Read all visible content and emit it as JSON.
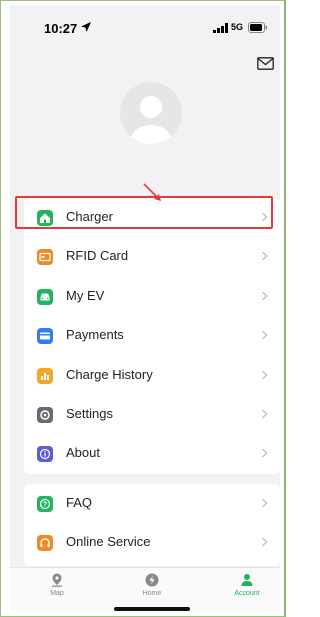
{
  "status": {
    "time": "10:27",
    "network": "5G"
  },
  "menu": [
    {
      "label": "Charger",
      "icon": "home-icon",
      "color": "#22b45e"
    },
    {
      "label": "RFID Card",
      "icon": "card-icon",
      "color": "#f08a24"
    },
    {
      "label": "My EV",
      "icon": "car-icon",
      "color": "#22b45e"
    },
    {
      "label": "Payments",
      "icon": "payment-card-icon",
      "color": "#2f7df0"
    },
    {
      "label": "Charge History",
      "icon": "bar-chart-icon",
      "color": "#f3a82b"
    },
    {
      "label": "Settings",
      "icon": "settings-icon",
      "color": "#666a73"
    },
    {
      "label": "About",
      "icon": "info-icon",
      "color": "#5b5fd6"
    }
  ],
  "menu2": [
    {
      "label": "FAQ",
      "icon": "question-icon",
      "color": "#22b45e"
    },
    {
      "label": "Online Service",
      "icon": "headset-icon",
      "color": "#f08a24"
    }
  ],
  "tabs": [
    {
      "label": "Map",
      "icon": "map-pin-icon"
    },
    {
      "label": "Home",
      "icon": "lightning-icon"
    },
    {
      "label": "Account",
      "icon": "person-icon",
      "active": true
    }
  ],
  "colors": {
    "accent": "#1fb25a",
    "highlight": "#e23b3b"
  }
}
